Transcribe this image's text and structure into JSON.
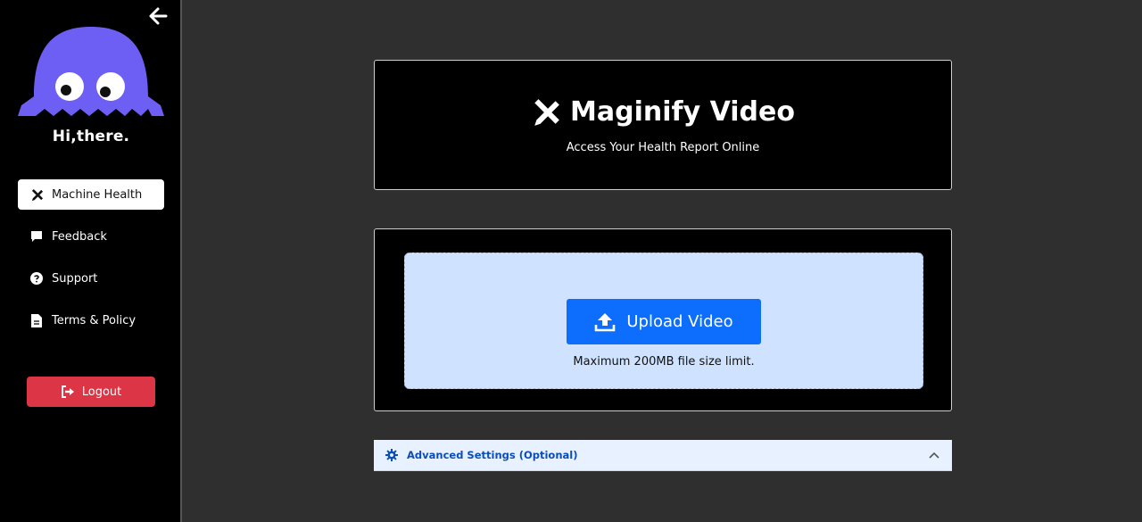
{
  "sidebar": {
    "greeting": "Hi,there.",
    "nav": [
      {
        "label": "Machine Health",
        "icon": "tools-icon",
        "active": true
      },
      {
        "label": "Feedback",
        "icon": "chat-icon"
      },
      {
        "label": "Support",
        "icon": "question-circle-icon"
      },
      {
        "label": "Terms & Policy",
        "icon": "document-icon"
      }
    ],
    "logout_label": "Logout"
  },
  "hero": {
    "title": "Maginify Video",
    "subtitle": "Access Your Health Report Online"
  },
  "upload": {
    "button_label": "Upload Video",
    "limit_text": "Maximum 200MB file size limit."
  },
  "advanced": {
    "label": "Advanced Settings (Optional)"
  },
  "colors": {
    "accent": "#0d6efd",
    "mascot": "#6e5ff4",
    "danger": "#dc3545",
    "dropzone": "#cfe2ff"
  }
}
